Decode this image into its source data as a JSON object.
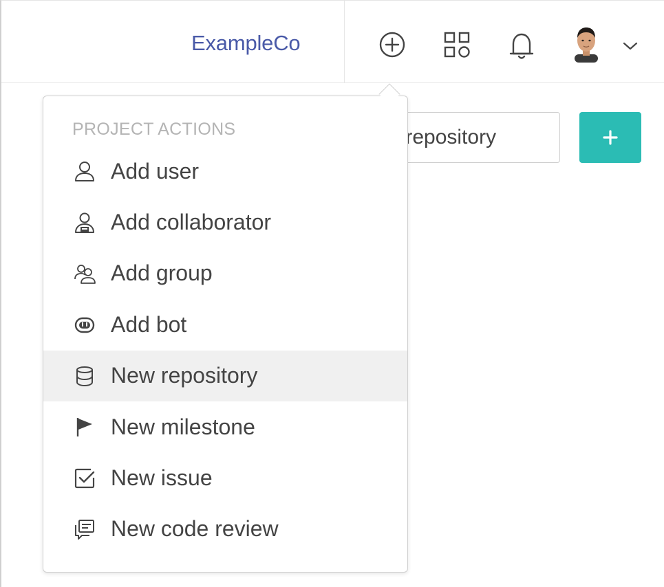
{
  "header": {
    "org_name": "ExampleCo",
    "icons": [
      "plus-circle-icon",
      "apps-grid-icon",
      "bell-icon",
      "avatar",
      "chevron-down-icon"
    ]
  },
  "background": {
    "repo_input_value": "New repository",
    "add_button_icon": "plus-icon",
    "add_button_color": "#2bbcb4"
  },
  "dropdown": {
    "heading": "PROJECT ACTIONS",
    "hovered_item": "New repository",
    "items": [
      {
        "label": "Add user",
        "icon": "user-icon"
      },
      {
        "label": "Add collaborator",
        "icon": "collaborator-icon"
      },
      {
        "label": "Add group",
        "icon": "group-icon"
      },
      {
        "label": "Add bot",
        "icon": "bot-icon"
      },
      {
        "label": "New repository",
        "icon": "database-icon"
      },
      {
        "label": "New milestone",
        "icon": "flag-icon"
      },
      {
        "label": "New issue",
        "icon": "checkbox-icon"
      },
      {
        "label": "New code review",
        "icon": "code-review-icon"
      }
    ]
  },
  "colors": {
    "org_name": "#4a5aa8",
    "accent": "#2bbcb4",
    "hover_bg": "#f0f0f0",
    "heading": "#b4b4b4"
  }
}
